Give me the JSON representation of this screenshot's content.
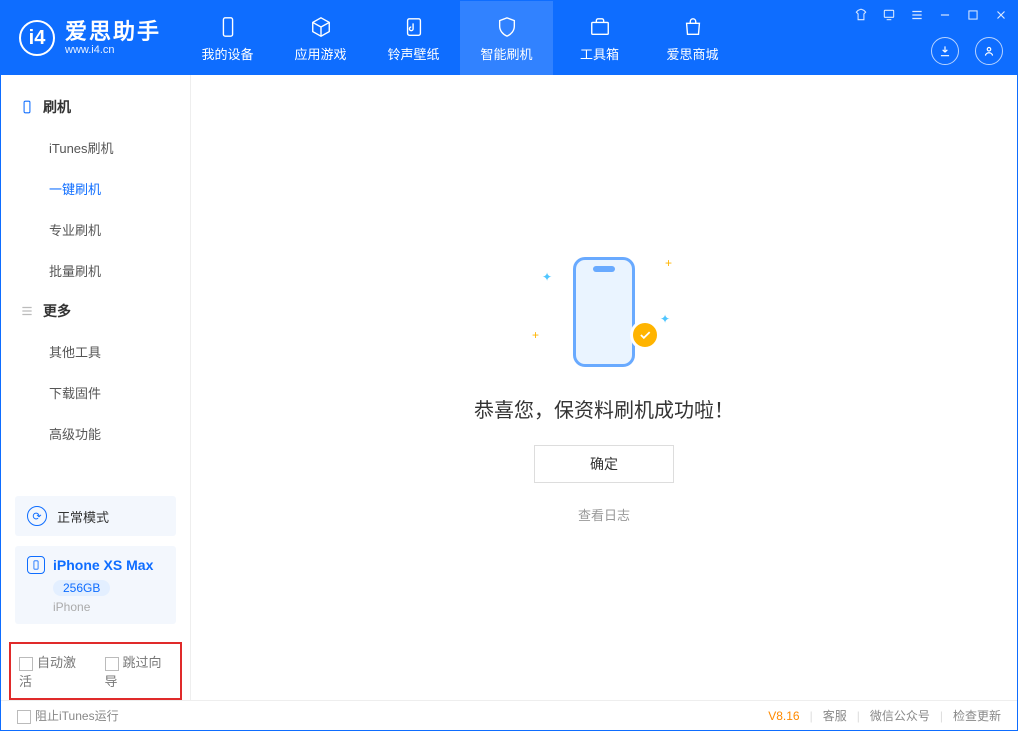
{
  "app": {
    "title": "爱思助手",
    "subtitle": "www.i4.cn"
  },
  "tabs": {
    "device": "我的设备",
    "apps": "应用游戏",
    "ringtone": "铃声壁纸",
    "flash": "智能刷机",
    "toolbox": "工具箱",
    "store": "爱思商城"
  },
  "sidebar": {
    "group1": "刷机",
    "group2": "更多",
    "items": {
      "itunes": "iTunes刷机",
      "oneclick": "一键刷机",
      "pro": "专业刷机",
      "batch": "批量刷机",
      "other": "其他工具",
      "firmware": "下载固件",
      "advanced": "高级功能"
    },
    "mode": "正常模式",
    "device_name": "iPhone XS Max",
    "device_capacity": "256GB",
    "device_type": "iPhone",
    "cb_auto_activate": "自动激活",
    "cb_skip_guide": "跳过向导"
  },
  "main": {
    "success": "恭喜您，保资料刷机成功啦！",
    "ok": "确定",
    "view_log": "查看日志"
  },
  "status": {
    "block_itunes": "阻止iTunes运行",
    "version": "V8.16",
    "support": "客服",
    "wechat": "微信公众号",
    "checkup": "检查更新"
  }
}
